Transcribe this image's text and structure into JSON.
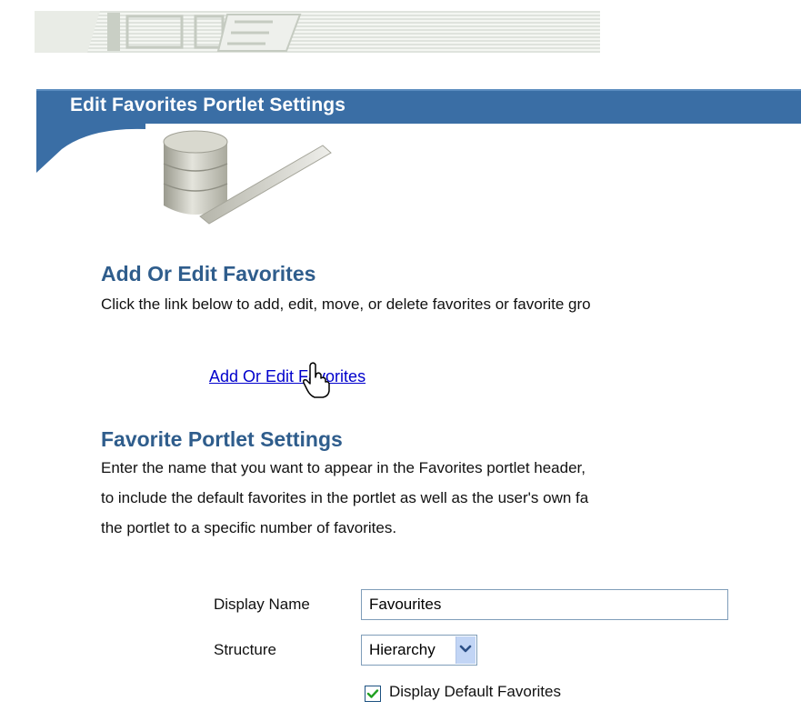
{
  "header": {
    "title": "Edit Favorites Portlet Settings"
  },
  "sections": {
    "add_edit": {
      "heading": "Add Or Edit Favorites",
      "description": "Click the link below to add, edit, move, or delete favorites or favorite gro",
      "link_label": "Add Or Edit Favorites"
    },
    "portlet_settings": {
      "heading": "Favorite Portlet Settings",
      "description_lines": [
        "Enter the name that you want to appear in the Favorites portlet header,",
        "to include the default favorites in the portlet as well as the user's own fa",
        "the portlet to a specific number of favorites."
      ]
    }
  },
  "form": {
    "display_name_label": "Display Name",
    "display_name_value": "Favourites",
    "structure_label": "Structure",
    "structure_value": "Hierarchy",
    "display_default_label": "Display Default Favorites",
    "display_default_checked": true
  },
  "colors": {
    "header_blue": "#3a6ea5",
    "heading_blue": "#2f5d8c",
    "link_blue": "#0000cc"
  }
}
